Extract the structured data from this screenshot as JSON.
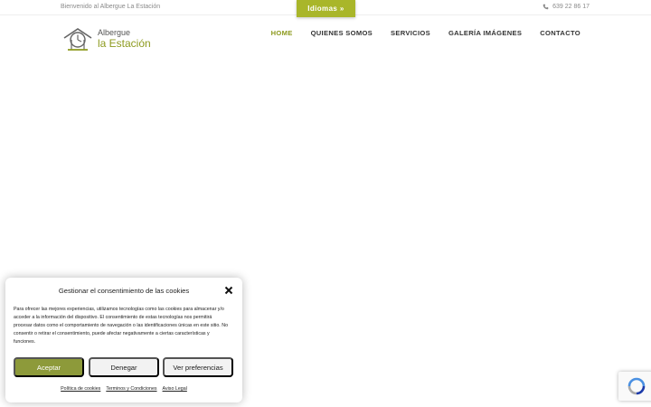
{
  "topbar": {
    "welcome": "Bienvenido al Albergue La Estación",
    "phone": "639 22 86 17",
    "language_button": "Idiomas »"
  },
  "logo": {
    "line1": "Albergue",
    "line2": "la Estación"
  },
  "nav": {
    "items": [
      {
        "label": "HOME",
        "active": true
      },
      {
        "label": "QUIENES SOMOS",
        "active": false
      },
      {
        "label": "SERVICIOS",
        "active": false
      },
      {
        "label": "GALERÍA IMÁGENES",
        "active": false
      },
      {
        "label": "CONTACTO",
        "active": false
      }
    ]
  },
  "cookie": {
    "title": "Gestionar el consentimiento de las cookies",
    "body": "Para ofrecer las mejores experiencias, utilizamos tecnologías como las cookies para almacenar y/o acceder a la información del dispositivo. El consentimiento de estas tecnologías nos permitirá procesar datos como el comportamiento de navegación o las identificaciones únicas en este sitio. No consentir o retirar el consentimiento, puede afectar negativamente a ciertas características y funciones.",
    "accept_label": "Aceptar",
    "deny_label": "Denegar",
    "prefs_label": "Ver preferencias",
    "links": [
      "Política de cookies",
      "Terminos y Condiciones",
      "Aviso Legal"
    ]
  },
  "colors": {
    "accent": "#8d9a1e",
    "language_button": "#a9b62a",
    "accept_button": "#8d9a3a"
  },
  "icons": [
    "phone-icon",
    "logo-icon",
    "close-icon",
    "recaptcha-icon"
  ]
}
